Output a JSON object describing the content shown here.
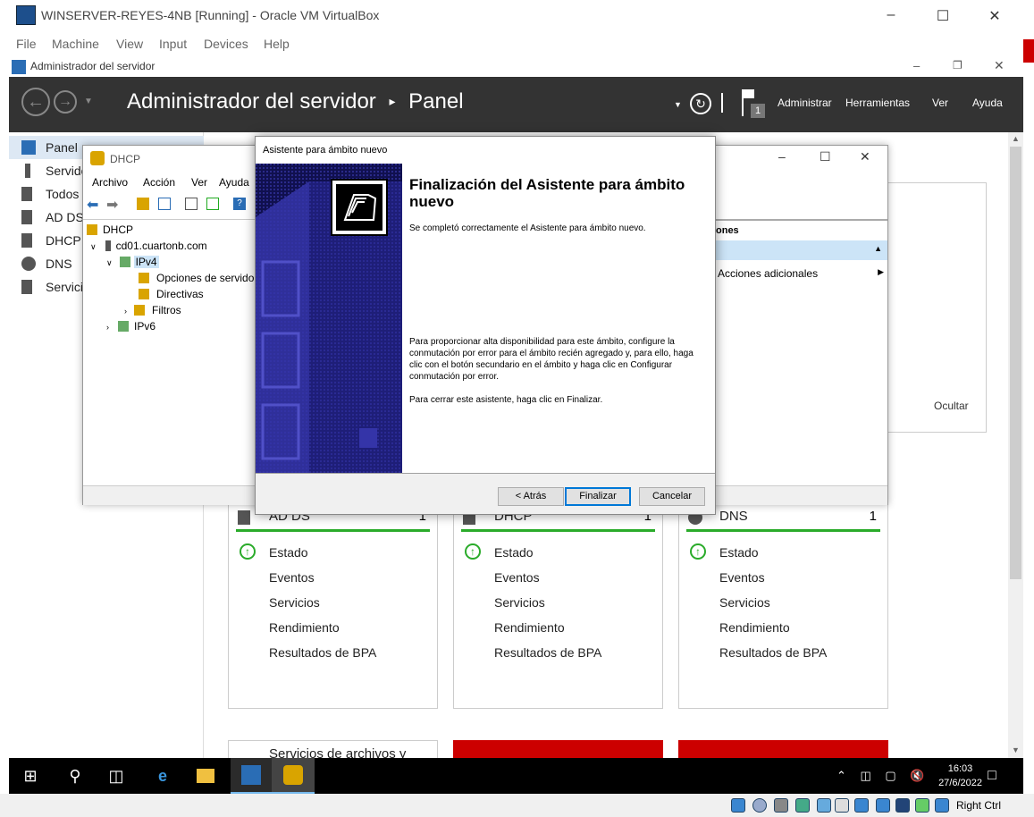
{
  "vbox": {
    "title": "WINSERVER-REYES-4NB [Running] - Oracle VM VirtualBox",
    "menu": [
      "File",
      "Machine",
      "View",
      "Input",
      "Devices",
      "Help"
    ],
    "status_right": "Right Ctrl"
  },
  "server_manager": {
    "window_title": "Administrador del servidor",
    "breadcrumb_app": "Administrador del servidor",
    "breadcrumb_sep": "▸",
    "breadcrumb_page": "Panel",
    "flag_count": "1",
    "header_menu": [
      "Administrar",
      "Herramientas",
      "Ver",
      "Ayuda"
    ],
    "nav": [
      "Panel",
      "Servido",
      "Todos",
      "AD DS",
      "DHCP",
      "DNS",
      "Servici"
    ],
    "tiles": [
      {
        "name": "AD DS",
        "count": "1",
        "rows": [
          "Estado",
          "Eventos",
          "Servicios",
          "Rendimiento",
          "Resultados de BPA"
        ]
      },
      {
        "name": "DHCP",
        "count": "1",
        "rows": [
          "Estado",
          "Eventos",
          "Servicios",
          "Rendimiento",
          "Resultados de BPA"
        ]
      },
      {
        "name": "DNS",
        "count": "1",
        "rows": [
          "Estado",
          "Eventos",
          "Servicios",
          "Rendimiento",
          "Resultados de BPA"
        ]
      }
    ],
    "bottom_tile": "Servicios de archivos y",
    "hide_label": "Ocultar"
  },
  "dhcp_console": {
    "title": "DHCP",
    "menu": [
      "Archivo",
      "Acción",
      "Ver",
      "Ayuda"
    ],
    "tree": {
      "root": "DHCP",
      "server": "cd01.cuartonb.com",
      "ipv4": "IPv4",
      "options": "Opciones de servidor",
      "policies": "Directivas",
      "filters": "Filtros",
      "ipv6": "IPv6"
    },
    "actions_header": "ones",
    "more_actions": "Acciones adicionales"
  },
  "wizard": {
    "title": "Asistente para ámbito nuevo",
    "heading": "Finalización del Asistente para ámbito nuevo",
    "p1": "Se completó correctamente el Asistente para ámbito nuevo.",
    "p2": "Para proporcionar alta disponibilidad para este ámbito, configure la conmutación por error para el ámbito recién agregado y, para ello, haga clic con el botón secundario en el ámbito y haga clic en Configurar conmutación por error.",
    "p3": "Para cerrar este asistente, haga clic en Finalizar.",
    "back": "< Atrás",
    "finish": "Finalizar",
    "cancel": "Cancelar"
  },
  "taskbar": {
    "time": "16:03",
    "date": "27/6/2022"
  }
}
